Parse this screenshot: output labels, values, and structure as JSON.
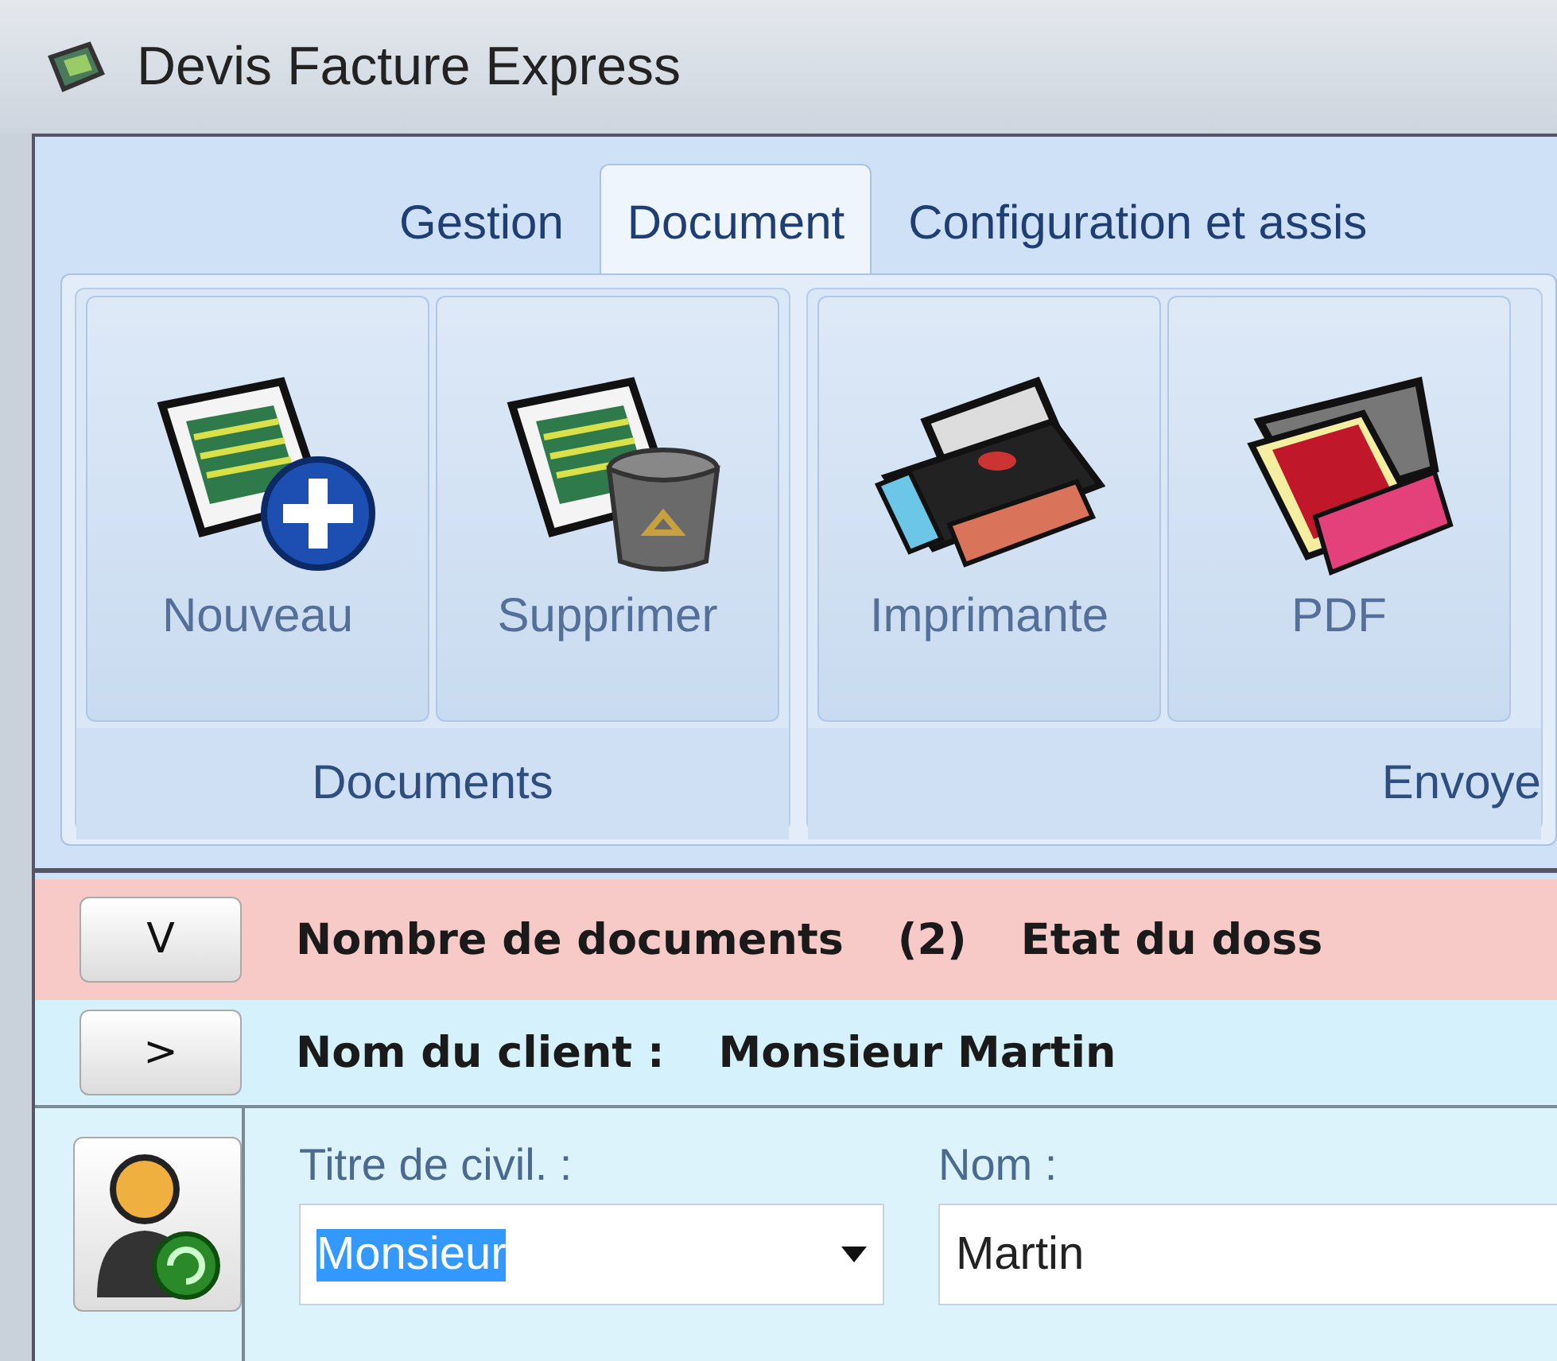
{
  "window": {
    "title": "Devis Facture Express"
  },
  "tabs": [
    {
      "label": "Gestion",
      "selected": false
    },
    {
      "label": "Document",
      "selected": true
    },
    {
      "label": "Configuration et assis",
      "selected": false
    }
  ],
  "ribbon_groups": [
    {
      "label": "Documents",
      "buttons": [
        {
          "label": "Nouveau",
          "kind": "new"
        },
        {
          "label": "Supprimer",
          "kind": "delete"
        }
      ]
    },
    {
      "label": "Envoye",
      "buttons": [
        {
          "label": "Imprimante",
          "kind": "printer"
        },
        {
          "label": "PDF",
          "kind": "pdf"
        }
      ]
    }
  ],
  "summary_bar": {
    "toggle": "V",
    "label": "Nombre de documents",
    "count": "(2)",
    "status_label": "Etat du doss"
  },
  "client_bar": {
    "toggle": ">",
    "label": "Nom du client :",
    "value": "Monsieur Martin"
  },
  "form": {
    "fields": [
      {
        "label": "Titre de civil. :",
        "value": "Monsieur",
        "kind": "dropdown",
        "highlighted": true
      },
      {
        "label": "Nom :",
        "value": "Martin",
        "kind": "text",
        "highlighted": false
      }
    ]
  }
}
